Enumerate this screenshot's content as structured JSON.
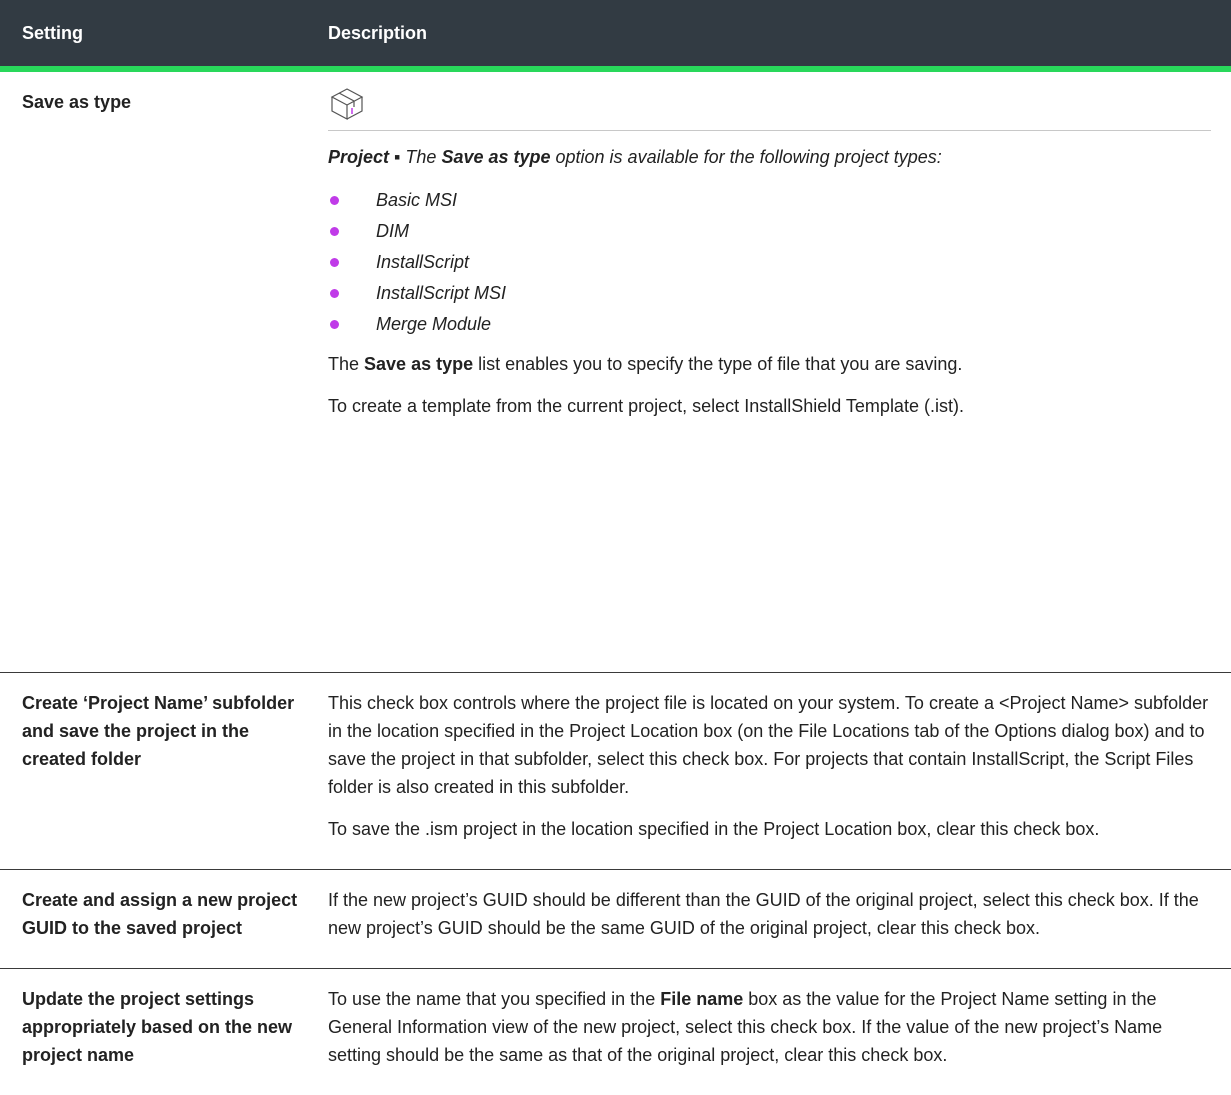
{
  "header": {
    "setting_col": "Setting",
    "description_col": "Description"
  },
  "rows": [
    {
      "setting": "Save as type",
      "icon": "package-box-icon",
      "project_label": "Project",
      "project_sep": " ▪ The ",
      "project_bold": "Save as type",
      "project_rest": " option is available for the following project types:",
      "types": [
        "Basic MSI",
        "DIM",
        "InstallScript",
        "InstallScript MSI",
        "Merge Module"
      ],
      "p1_pre": "The ",
      "p1_bold": "Save as type",
      "p1_post": " list enables you to specify the type of file that you are saving.",
      "p2": "To create a template from the current project, select InstallShield Template (.ist)."
    },
    {
      "setting": "Create ‘Project Name’ subfolder and save the project in the created folder",
      "p1": "This check box controls where the project file is located on your system. To create a <Project Name> subfolder in the location specified in the Project Location box (on the File Locations tab of the Options dialog box) and to save the project in that subfolder, select this check box. For projects that contain InstallScript, the Script Files folder is also created in this subfolder.",
      "p2": "To save the .ism project in the location specified in the Project Location box, clear this check box."
    },
    {
      "setting": "Create and assign a new project GUID to the saved project",
      "p1": "If the new project’s GUID should be different than the GUID of the original project, select this check box. If the new project’s GUID should be the same GUID of the original project, clear this check box."
    },
    {
      "setting": "Update the project settings appropriately based on the new project name",
      "p1_pre": "To use the name that you specified in the ",
      "p1_bold": "File name",
      "p1_post": " box as the value for the Project Name setting in the General Information view of the new project, select this check box. If the value of the new project’s Name setting should be the same as that of the original project, clear this check box."
    }
  ]
}
